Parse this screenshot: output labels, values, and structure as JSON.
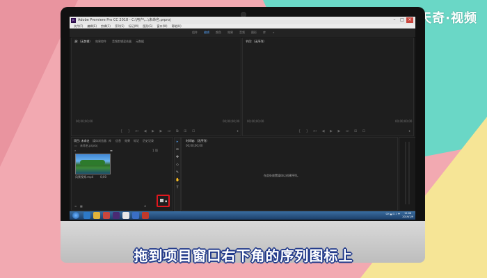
{
  "watermark": "天奇·视频",
  "caption": "拖到项目窗口右下角的序列图标上",
  "app": {
    "title": "Adobe Premiere Pro CC 2018 - C:\\用户\\...\\未命名.prproj",
    "menu": [
      "文件(F)",
      "编辑(E)",
      "剪辑(C)",
      "序列(S)",
      "标记(M)",
      "图形(G)",
      "窗口(W)",
      "帮助(H)"
    ],
    "workspaces": [
      {
        "label": "组件",
        "active": false
      },
      {
        "label": "编辑",
        "active": true
      },
      {
        "label": "颜色",
        "active": false
      },
      {
        "label": "效果",
        "active": false
      },
      {
        "label": "音频",
        "active": false
      },
      {
        "label": "图形",
        "active": false
      },
      {
        "label": "库",
        "active": false
      },
      {
        "label": "»",
        "active": false
      }
    ],
    "source_panel": {
      "tabs": [
        "源:（无剪辑）",
        "效果控件",
        "音频剪辑混合器",
        "元数据"
      ],
      "timecode_left": "00;00;00;00",
      "timecode_right": "00;00;00;00",
      "controls": "{ } ⏮ ◀ ▶ ▶ ⏭ ⧉ ⊞ ⊡"
    },
    "program_panel": {
      "tabs": [
        "节目:（无序列）"
      ],
      "timecode_left": "00;00;00;00",
      "timecode_right": "00;00;00;00",
      "controls": "{ } ⏮ ◀ ▶ ▶ ⏭ ⊞ ⊡"
    },
    "project_panel": {
      "tabs": [
        "项目: 未命名",
        "媒体浏览器",
        "库",
        "信息",
        "效果",
        "标记",
        "历史记录"
      ],
      "path": "未命名.prproj",
      "count": "1 项",
      "clip_label": "风景视频.mp4",
      "clip_duration": "0;00"
    },
    "timeline_panel": {
      "tabs": [
        "时间轴:（无序列）"
      ],
      "timecode": "00;00;00;00",
      "empty_message": "在此处放置媒体以创建序列。"
    },
    "tools": [
      "▸",
      "⇹",
      "✥",
      "◇",
      "✎",
      "✋",
      "T"
    ],
    "taskbar": {
      "tray_text": "CH ▲ ⊡ ♪ ⚑",
      "time": "12:06",
      "date": "2019/1/9"
    }
  }
}
